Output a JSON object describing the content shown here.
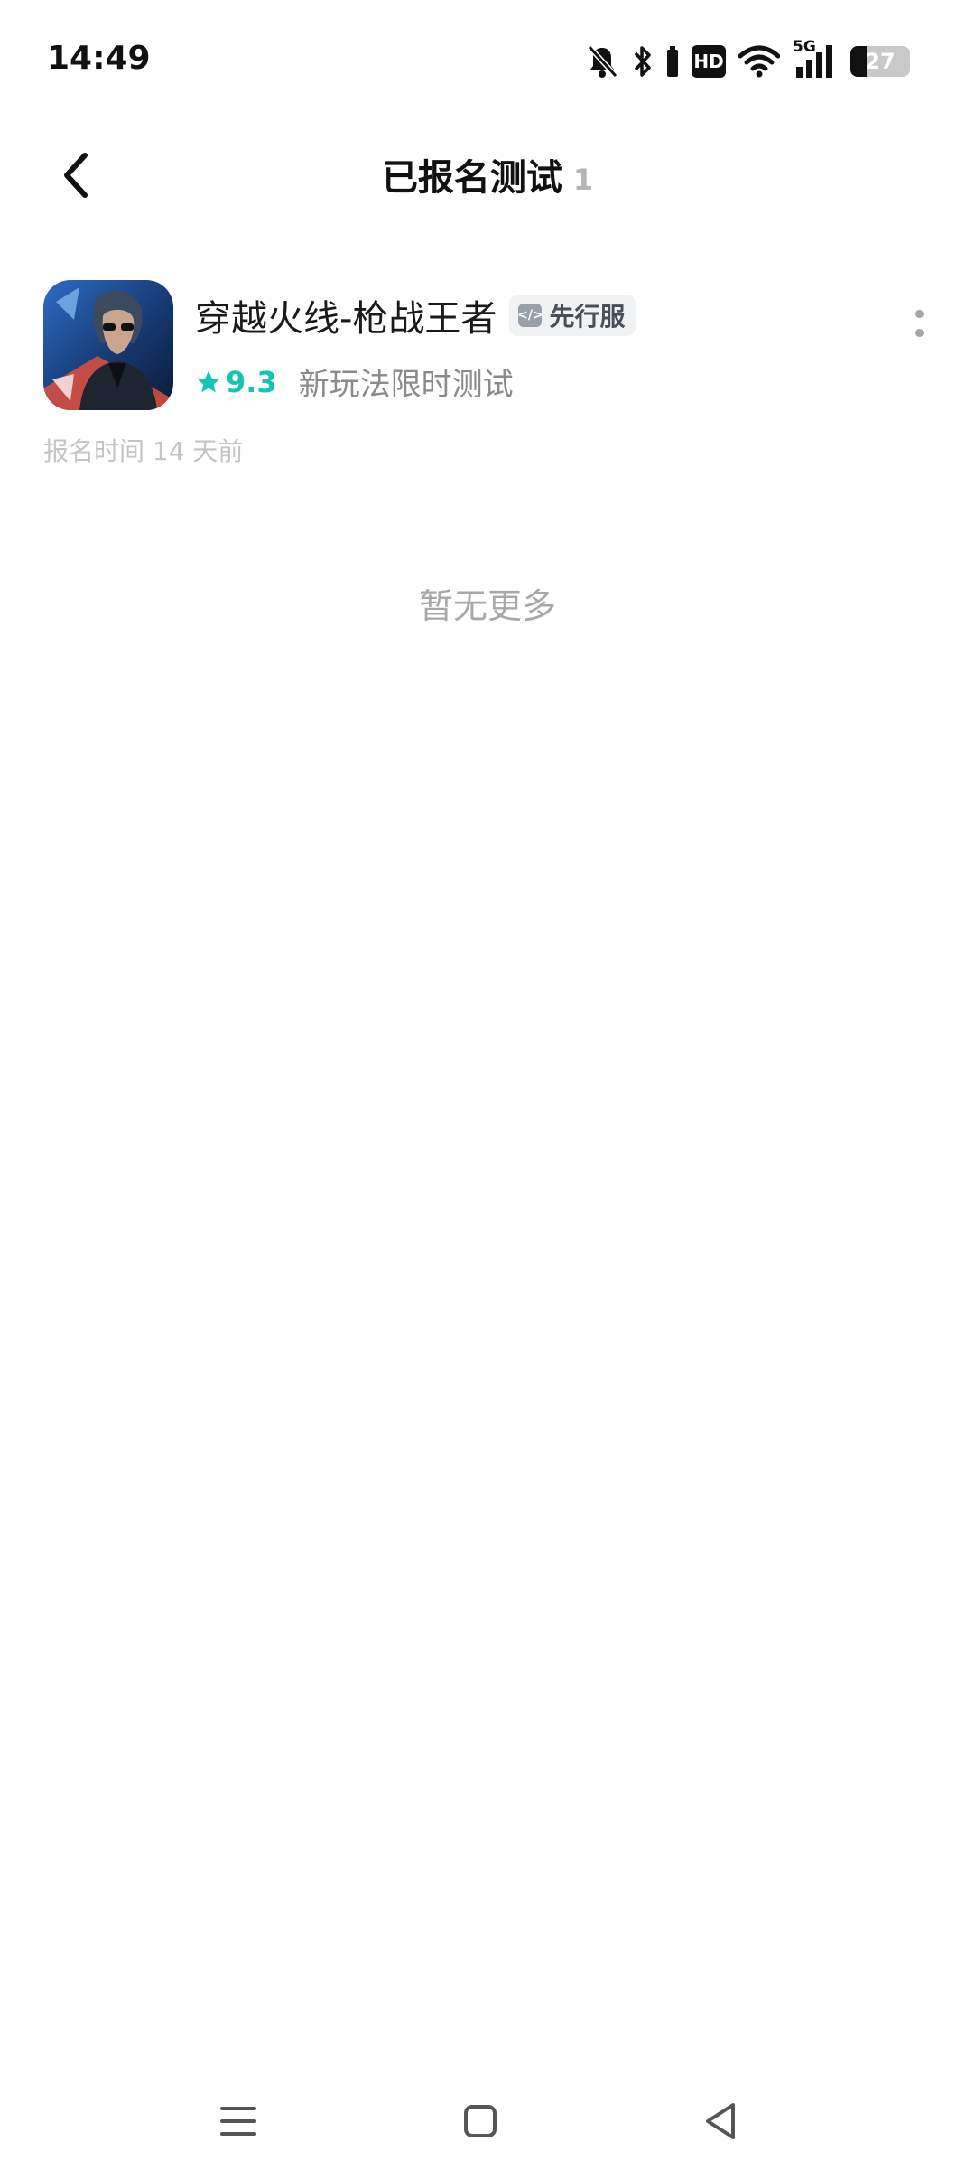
{
  "status_bar": {
    "time": "14:49",
    "icons": [
      "bell-off-icon",
      "bluetooth-icon",
      "battery-mini-icon",
      "hd-icon",
      "wifi-icon",
      "5g-signal-icon",
      "battery-icon"
    ],
    "hd_label": "HD",
    "network_label": "5G",
    "battery_level": "27",
    "battery_fraction": 0.27
  },
  "header": {
    "title": "已报名测试",
    "count": "1"
  },
  "games": [
    {
      "title": "穿越火线-枪战王者",
      "badge": "先行服",
      "rating": "9.3",
      "description": "新玩法限时测试",
      "signup_time": "报名时间 14 天前"
    }
  ],
  "list_footer": "暂无更多",
  "colors": {
    "accent": "#14c4b4",
    "muted_text": "#8a8a8a",
    "faint_text": "#c4c4c4"
  }
}
